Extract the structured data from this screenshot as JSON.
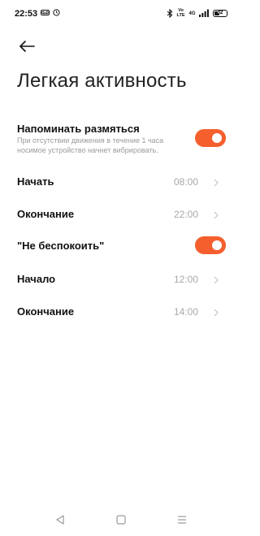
{
  "status_bar": {
    "time": "22:53",
    "volte_top": "Vo",
    "volte_bottom": "LTE",
    "network": "4G",
    "battery_level": "42",
    "left_icons": [
      "voicemail-icon",
      "alarm-clock-icon"
    ],
    "right_icons": [
      "bluetooth-icon",
      "volte-icon",
      "signal-icon",
      "battery-icon"
    ]
  },
  "header": {
    "back_icon": "arrow-left-icon",
    "title": "Легкая активность"
  },
  "settings": {
    "reminder": {
      "label": "Напоминать размяться",
      "description": "При отсутствии движения в течение 1 часа носимое устройство начнет вибрировать.",
      "enabled": true
    },
    "start": {
      "label": "Начать",
      "value": "08:00"
    },
    "end": {
      "label": "Окончание",
      "value": "22:00"
    },
    "dnd": {
      "label": "\"Не беспокоить\"",
      "enabled": true
    },
    "dnd_start": {
      "label": "Начало",
      "value": "12:00"
    },
    "dnd_end": {
      "label": "Окончание",
      "value": "14:00"
    }
  },
  "colors": {
    "accent": "#f55f2e",
    "value_gray": "#a9a9a9",
    "desc_gray": "#9b9b9b"
  },
  "nav_bar": {
    "icons": [
      "back-triangle-icon",
      "home-square-icon",
      "menu-lines-icon"
    ]
  }
}
